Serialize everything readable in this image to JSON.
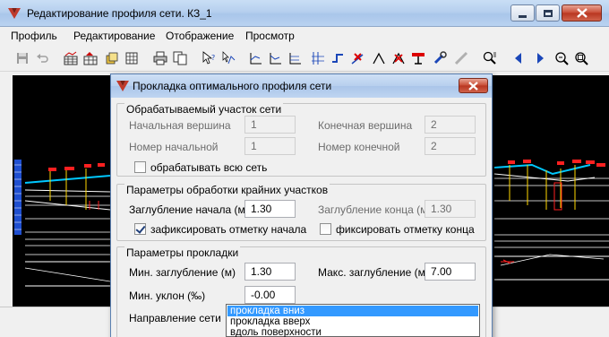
{
  "window": {
    "title": "Редактирование профиля сети. КЗ_1"
  },
  "menu": [
    "Профиль",
    "Редактирование",
    "Отображение",
    "Просмотр"
  ],
  "dialog": {
    "title": "Прокладка оптимального профиля сети",
    "group1": {
      "title": "Обрабатываемый участок сети",
      "start_vertex_label": "Начальная вершина",
      "start_vertex_value": "1",
      "end_vertex_label": "Конечная вершина",
      "end_vertex_value": "2",
      "start_number_label": "Номер начальной",
      "start_number_value": "1",
      "end_number_label": "Номер конечной",
      "end_number_value": "2",
      "process_all_label": "обрабатывать всю сеть",
      "process_all_checked": false
    },
    "group2": {
      "title": "Параметры обработки крайних участков",
      "start_depth_label": "Заглубление начала (м)",
      "start_depth_value": "1.30",
      "end_depth_label": "Заглубление конца (м)",
      "end_depth_value": "1.30",
      "fix_start_label": "зафиксировать отметку начала",
      "fix_start_checked": true,
      "fix_end_label": "фиксировать отметку конца",
      "fix_end_checked": false
    },
    "group3": {
      "title": "Параметры прокладки",
      "min_depth_label": "Мин. заглубление (м)",
      "min_depth_value": "1.30",
      "max_depth_label": "Макс. заглубление (м)",
      "max_depth_value": "7.00",
      "min_slope_label": "Мин. уклон  (‰)",
      "min_slope_value": "-0.00",
      "direction_label": "Направление сети",
      "direction_options": [
        "прокладка вниз",
        "прокладка вверх",
        "вдоль поверхности"
      ],
      "direction_selected_index": 0
    }
  },
  "colors": {
    "canvas_bg": "#000000",
    "selection": "#3399ff",
    "profile_line": "#00c8ff",
    "marker_red": "#ff2020",
    "marker_yellow": "#ffd800"
  }
}
